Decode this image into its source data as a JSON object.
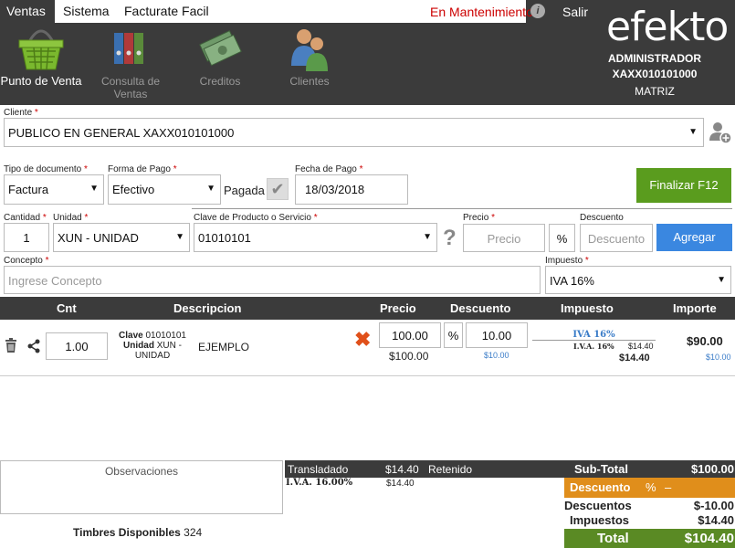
{
  "menu": {
    "ventas": "Ventas",
    "sistema": "Sistema",
    "facturate": "Facturate Facil",
    "mantenimiento": "En Mantenimiento",
    "info": "i",
    "salir": "Salir"
  },
  "brand": {
    "logo": "efekto",
    "role": "ADMINISTRADOR",
    "rfc": "XAXX010101000",
    "branch": "MATRIZ"
  },
  "toolbar": [
    {
      "label": "Punto de Venta",
      "icon": "basket-icon"
    },
    {
      "label": "Consulta de Ventas",
      "icon": "binders-icon"
    },
    {
      "label": "Creditos",
      "icon": "money-icon"
    },
    {
      "label": "Clientes",
      "icon": "users-icon"
    }
  ],
  "form": {
    "cliente_label": "Cliente",
    "cliente_value": "PUBLICO EN GENERAL XAXX010101000",
    "tipo_label": "Tipo de documento",
    "tipo_value": "Factura",
    "forma_label": "Forma de Pago",
    "forma_value": "Efectivo",
    "pagada_label": "Pagada",
    "fecha_label": "Fecha de Pago",
    "fecha_value": "18/03/2018",
    "finalizar": "Finalizar F12",
    "cantidad_label": "Cantidad",
    "cantidad_value": "1",
    "unidad_label": "Unidad",
    "unidad_value": "XUN - UNIDAD",
    "clave_label": "Clave de Producto o Servicio",
    "clave_value": "01010101",
    "help": "?",
    "precio_label": "Precio",
    "precio_placeholder": "Precio",
    "pct": "%",
    "descuento_label": "Descuento",
    "descuento_placeholder": "Descuento",
    "agregar": "Agregar",
    "concepto_label": "Concepto",
    "concepto_placeholder": "Ingrese Concepto",
    "impuesto_label": "Impuesto",
    "impuesto_value": "IVA 16%"
  },
  "table": {
    "headers": [
      "Cnt",
      "Descripcion",
      "Precio",
      "Descuento",
      "Impuesto",
      "Importe"
    ],
    "row": {
      "cnt": "1.00",
      "clave_lbl": "Clave",
      "clave": "01010101",
      "unidad_lbl": "Unidad",
      "unidad": "XUN - UNIDAD",
      "desc": "EJEMPLO",
      "precio": "100.00",
      "precio_sub": "$100.00",
      "pct": "%",
      "descuento": "10.00",
      "descuento_sub": "$10.00",
      "imp_name": "IVA 16%",
      "imp_line": "I.V.A. 16%",
      "imp_amount": "$14.40",
      "imp_total": "$14.40",
      "importe": "$90.00",
      "importe_sub": "$10.00"
    }
  },
  "footer": {
    "observaciones": "Observaciones",
    "trasladado": "Translad­ado",
    "trasladado_amt": "$14.40",
    "retenido": "Retenido",
    "iva_line": "I.V.A. 16.00%",
    "iva_amt": "$14.40",
    "timbres_lbl": "Timbres Disponibles",
    "timbres": "324",
    "subtotal_lbl": "Sub-Total",
    "subtotal": "$100.00",
    "descuento_lbl": "Descuento",
    "descuento_pct": "%",
    "descuento_dash": "–",
    "descuentos_lbl": "Descuentos",
    "descuentos": "$-10.00",
    "impuestos_lbl": "Impuestos",
    "impuestos": "$14.40",
    "total_lbl": "Total",
    "total": "$104.40"
  }
}
